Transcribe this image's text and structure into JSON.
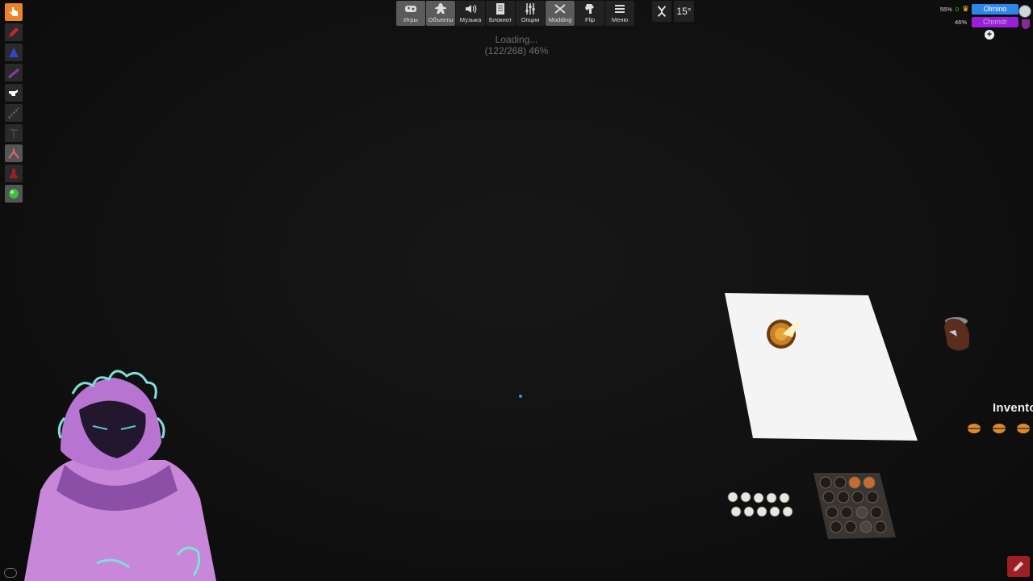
{
  "toolbar": {
    "buttons": [
      {
        "label": "Игры",
        "icon": "gamepad-icon",
        "selected": true
      },
      {
        "label": "Объекты",
        "icon": "meeple-icon",
        "selected": true
      },
      {
        "label": "Музыка",
        "icon": "speaker-icon",
        "selected": false
      },
      {
        "label": "Блокнот",
        "icon": "notebook-icon",
        "selected": false
      },
      {
        "label": "Опции",
        "icon": "sliders-icon",
        "selected": false
      },
      {
        "label": "Modding",
        "icon": "tools-icon",
        "selected": true
      },
      {
        "label": "Flip",
        "icon": "flip-hand-icon",
        "selected": false
      },
      {
        "label": "Меню",
        "icon": "menu-icon",
        "selected": false
      }
    ],
    "rotation_angle": "15°"
  },
  "loading": {
    "line1": "Loading...",
    "line2": "(122/268) 46%"
  },
  "players": {
    "host": {
      "percent": "55%",
      "score": "0",
      "name": "Olmino",
      "color": "#2f86e8"
    },
    "guest": {
      "percent": "46%",
      "name": "Chrmdr",
      "color": "#9b1fd8"
    }
  },
  "table": {
    "inventory_label": "Inventory"
  },
  "tools": [
    {
      "name": "grab-tool",
      "active": true
    },
    {
      "name": "pen-tool"
    },
    {
      "name": "zone-tool"
    },
    {
      "name": "line-tool"
    },
    {
      "name": "flick-tool"
    },
    {
      "name": "measure-tool"
    },
    {
      "name": "text-tool"
    },
    {
      "name": "snap-tool"
    },
    {
      "name": "joint-tool"
    },
    {
      "name": "gizmo-tool"
    }
  ],
  "colors": {
    "active_tool": "#e8842c",
    "background": "#121212",
    "accent_pen": "#9c1f25"
  }
}
